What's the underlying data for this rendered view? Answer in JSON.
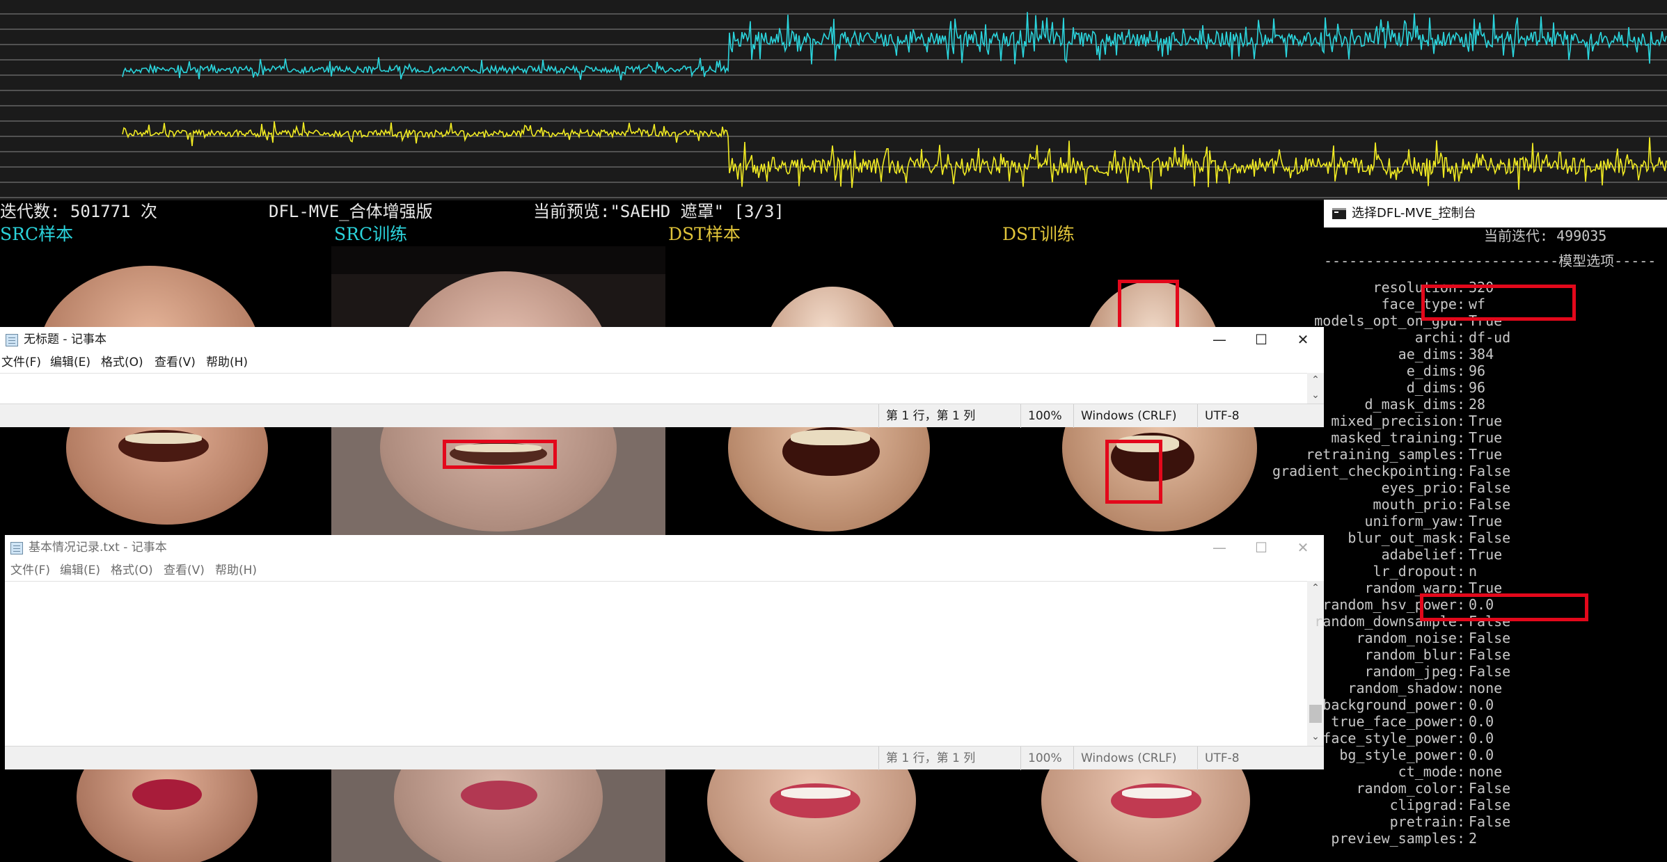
{
  "graph": {
    "series_colors": {
      "src_loss": "#2bd4dc",
      "dst_loss": "#f0ea23"
    },
    "background": "#1b1b1b"
  },
  "preview": {
    "status": {
      "iter_label": "迭代数: 501771 次",
      "version": "DFL-MVE_合体增强版",
      "current_preview": "当前预览:\"SAEHD 遮罩\" [3/3]"
    },
    "columns": [
      {
        "label": "SRC样本",
        "color": "#2bd4dc"
      },
      {
        "label": "SRC训练",
        "color": "#2bd4dc"
      },
      {
        "label": "DST样本",
        "color": "#e1c53a"
      },
      {
        "label": "DST训练",
        "color": "#e1c53a"
      }
    ]
  },
  "notepad1": {
    "title": "无标题 - 记事本",
    "controls": {
      "minimize": "—",
      "maximize": "☐",
      "close": "✕"
    },
    "menu": [
      "文件(F)",
      "编辑(E)",
      "格式(O)",
      "查看(V)",
      "帮助(H)"
    ],
    "content": "",
    "status": {
      "position": "第 1 行，第 1 列",
      "zoom": "100%",
      "line_ending": "Windows (CRLF)",
      "encoding": "UTF-8"
    }
  },
  "notepad2": {
    "title": "基本情况记录.txt - 记事本",
    "controls": {
      "minimize": "—",
      "maximize": "☐",
      "close": "✕"
    },
    "menu": [
      "文件(F)",
      "编辑(E)",
      "格式(O)",
      "查看(V)",
      "帮助(H)"
    ],
    "content": "",
    "status": {
      "position": "第 1 行，第 1 列",
      "zoom": "100%",
      "line_ending": "Windows (CRLF)",
      "encoding": "UTF-8"
    }
  },
  "console": {
    "title": "选择DFL-MVE_控制台",
    "current_iter": "当前迭代: 499035",
    "section_header": "----------------------------模型选项-----",
    "options": [
      {
        "key": "resolution",
        "value": "320"
      },
      {
        "key": "face_type",
        "value": "wf"
      },
      {
        "key": "models_opt_on_gpu",
        "value": "True"
      },
      {
        "key": "archi",
        "value": "df-ud"
      },
      {
        "key": "ae_dims",
        "value": "384"
      },
      {
        "key": "e_dims",
        "value": "96"
      },
      {
        "key": "d_dims",
        "value": "96"
      },
      {
        "key": "d_mask_dims",
        "value": "28"
      },
      {
        "key": "mixed_precision",
        "value": "True"
      },
      {
        "key": "masked_training",
        "value": "True"
      },
      {
        "key": "retraining_samples",
        "value": "True"
      },
      {
        "key": "gradient_checkpointing",
        "value": "False"
      },
      {
        "key": "eyes_prio",
        "value": "False"
      },
      {
        "key": "mouth_prio",
        "value": "False"
      },
      {
        "key": "uniform_yaw",
        "value": "True"
      },
      {
        "key": "blur_out_mask",
        "value": "False"
      },
      {
        "key": "adabelief",
        "value": "True"
      },
      {
        "key": "lr_dropout",
        "value": "n"
      },
      {
        "key": "random_warp",
        "value": "True"
      },
      {
        "key": "random_hsv_power",
        "value": "0.0"
      },
      {
        "key": "random_downsample",
        "value": "False"
      },
      {
        "key": "random_noise",
        "value": "False"
      },
      {
        "key": "random_blur",
        "value": "False"
      },
      {
        "key": "random_jpeg",
        "value": "False"
      },
      {
        "key": "random_shadow",
        "value": "none"
      },
      {
        "key": "background_power",
        "value": "0.0"
      },
      {
        "key": "true_face_power",
        "value": "0.0"
      },
      {
        "key": "face_style_power",
        "value": "0.0"
      },
      {
        "key": "bg_style_power",
        "value": "0.0"
      },
      {
        "key": "ct_mode",
        "value": "none"
      },
      {
        "key": "random_color",
        "value": "False"
      },
      {
        "key": "clipgrad",
        "value": "False"
      },
      {
        "key": "pretrain",
        "value": "False"
      },
      {
        "key": "preview_samples",
        "value": "2"
      }
    ]
  },
  "highlight_color": "#e3081b"
}
